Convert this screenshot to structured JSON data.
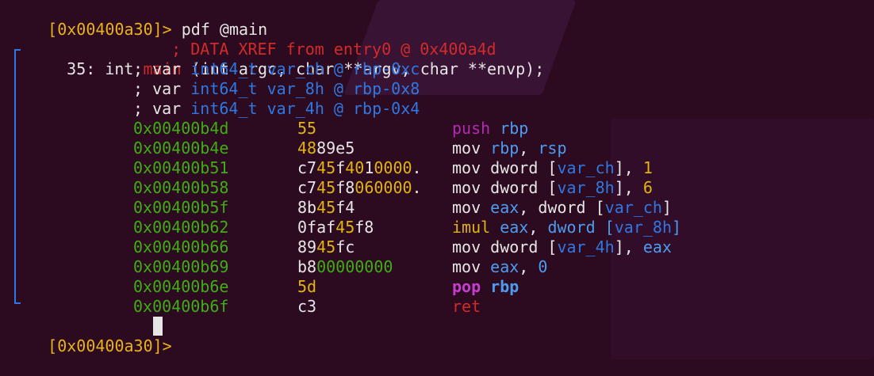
{
  "colors": {
    "background": "#2c0a1f",
    "prompt": "#e8b31b",
    "address": "#3fae14",
    "xref": "#d12b2b",
    "type": "#2f78e3",
    "register": "#4d9cf0",
    "push_mnemonic": "#b22bb3"
  },
  "prompt1": {
    "prompt": "[0x00400a30]>",
    "command": " pdf @main"
  },
  "xref": "; DATA XREF from entry0 @ 0x400a4d",
  "signature": {
    "size": "35: int",
    "name": "main",
    "rest": " (int argc, char **argv, char **envp);"
  },
  "vars": [
    {
      "prefix": "; var",
      "type": "int64_t",
      "name": "var_ch",
      "loc": "@ rbp-0xc"
    },
    {
      "prefix": "; var",
      "type": "int64_t",
      "name": "var_8h",
      "loc": "@ rbp-0x8"
    },
    {
      "prefix": "; var",
      "type": "int64_t",
      "name": "var_4h",
      "loc": "@ rbp-0x4"
    }
  ],
  "instructions": [
    {
      "addr": "0x00400b4d",
      "bytes": [
        {
          "t": "55",
          "c": "y"
        }
      ],
      "op": [
        {
          "t": "push",
          "c": "mn-magenta"
        },
        {
          "t": " rbp",
          "c": "reg"
        }
      ]
    },
    {
      "addr": "0x00400b4e",
      "bytes": [
        {
          "t": "48",
          "c": "y"
        },
        {
          "t": "89e5",
          "c": "w"
        }
      ],
      "op": [
        {
          "t": "mov",
          "c": "mn-white"
        },
        {
          "t": " rbp",
          "c": "reg"
        },
        {
          "t": ", ",
          "c": "mn-white"
        },
        {
          "t": "rsp",
          "c": "reg"
        }
      ]
    },
    {
      "addr": "0x00400b51",
      "bytes": [
        {
          "t": "c7",
          "c": "w"
        },
        {
          "t": "45",
          "c": "y"
        },
        {
          "t": "f",
          "c": "w"
        },
        {
          "t": "40",
          "c": "y"
        },
        {
          "t": "1",
          "c": "w"
        },
        {
          "t": "0000",
          "c": "y"
        },
        {
          "t": ".",
          "c": "w"
        }
      ],
      "op": [
        {
          "t": "mov dword [",
          "c": "mn-white"
        },
        {
          "t": "var_ch",
          "c": "type"
        },
        {
          "t": "], ",
          "c": "mn-white"
        },
        {
          "t": "1",
          "c": "mn-yellow"
        }
      ]
    },
    {
      "addr": "0x00400b58",
      "bytes": [
        {
          "t": "c7",
          "c": "w"
        },
        {
          "t": "45",
          "c": "y"
        },
        {
          "t": "f8",
          "c": "w"
        },
        {
          "t": "06",
          "c": "y"
        },
        {
          "t": "0000",
          "c": "y"
        },
        {
          "t": ".",
          "c": "w"
        }
      ],
      "op": [
        {
          "t": "mov dword [",
          "c": "mn-white"
        },
        {
          "t": "var_8h",
          "c": "type"
        },
        {
          "t": "], ",
          "c": "mn-white"
        },
        {
          "t": "6",
          "c": "mn-yellow"
        }
      ]
    },
    {
      "addr": "0x00400b5f",
      "bytes": [
        {
          "t": "8b",
          "c": "w"
        },
        {
          "t": "45",
          "c": "y"
        },
        {
          "t": "f4",
          "c": "w"
        }
      ],
      "op": [
        {
          "t": "mov",
          "c": "mn-white"
        },
        {
          "t": " eax",
          "c": "reg"
        },
        {
          "t": ", dword [",
          "c": "mn-white"
        },
        {
          "t": "var_ch",
          "c": "type"
        },
        {
          "t": "]",
          "c": "mn-white"
        }
      ]
    },
    {
      "addr": "0x00400b62",
      "bytes": [
        {
          "t": "0faf",
          "c": "w"
        },
        {
          "t": "45",
          "c": "y"
        },
        {
          "t": "f8",
          "c": "w"
        }
      ],
      "op": [
        {
          "t": "imul",
          "c": "mn-yellow"
        },
        {
          "t": " eax",
          "c": "reg"
        },
        {
          "t": ", ",
          "c": "mn-white"
        },
        {
          "t": "dword [",
          "c": "reg"
        },
        {
          "t": "var_8h",
          "c": "type"
        },
        {
          "t": "]",
          "c": "reg"
        }
      ]
    },
    {
      "addr": "0x00400b66",
      "bytes": [
        {
          "t": "89",
          "c": "w"
        },
        {
          "t": "45",
          "c": "y"
        },
        {
          "t": "fc",
          "c": "w"
        }
      ],
      "op": [
        {
          "t": "mov dword [",
          "c": "mn-white"
        },
        {
          "t": "var_4h",
          "c": "type"
        },
        {
          "t": "], ",
          "c": "mn-white"
        },
        {
          "t": "eax",
          "c": "reg"
        }
      ]
    },
    {
      "addr": "0x00400b69",
      "bytes": [
        {
          "t": "b8",
          "c": "w"
        },
        {
          "t": "00000000",
          "c": "g"
        }
      ],
      "op": [
        {
          "t": "mov",
          "c": "mn-white"
        },
        {
          "t": " eax",
          "c": "reg"
        },
        {
          "t": ", ",
          "c": "mn-white"
        },
        {
          "t": "0",
          "c": "reg"
        }
      ]
    },
    {
      "addr": "0x00400b6e",
      "bytes": [
        {
          "t": "5d",
          "c": "y"
        }
      ],
      "op": [
        {
          "t": "pop",
          "c": "mn-magenta-b"
        },
        {
          "t": " rbp",
          "c": "reg-b"
        }
      ]
    },
    {
      "addr": "0x00400b6f",
      "bytes": [
        {
          "t": "c3",
          "c": "w"
        }
      ],
      "op": [
        {
          "t": "ret",
          "c": "mn-red"
        }
      ]
    }
  ],
  "prompt2": {
    "prompt": "[0x00400a30]>"
  }
}
